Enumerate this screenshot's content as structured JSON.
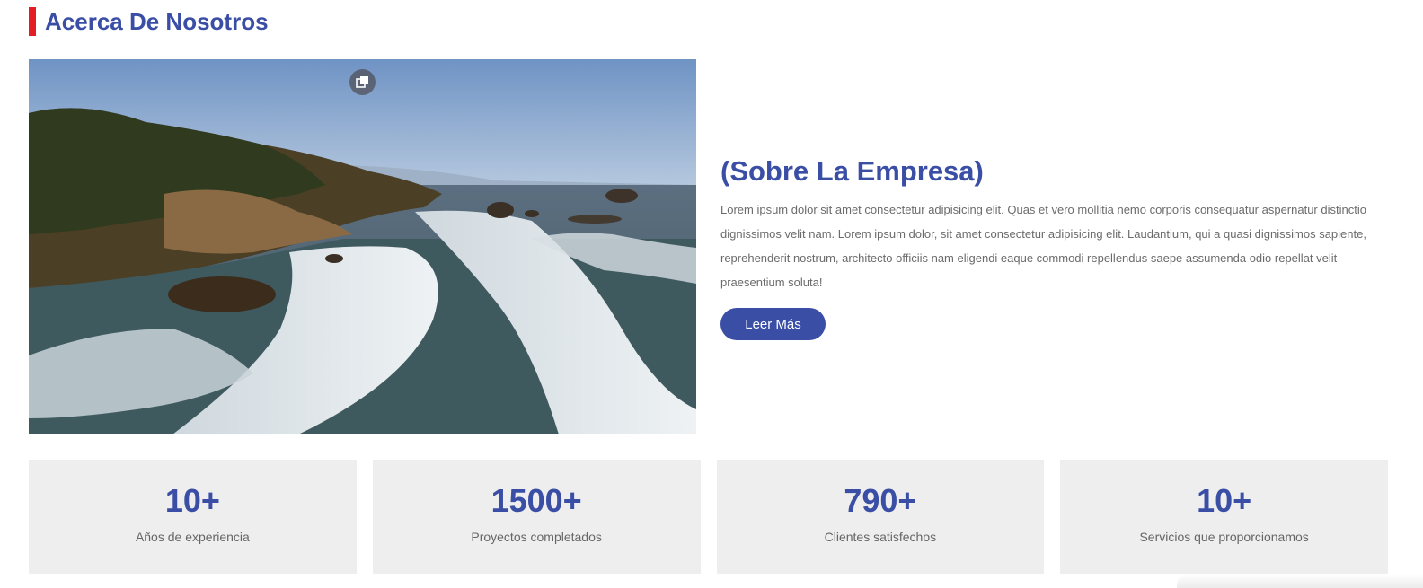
{
  "section": {
    "heading": "Acerca De Nosotros",
    "accent_color": "#e31e24",
    "brand_color": "#3a4ea6"
  },
  "hero": {
    "image_alt": "coastal-cliffs-and-waves",
    "badge_icon": "gallery-icon"
  },
  "about": {
    "title": "(Sobre La Empresa)",
    "body": "Lorem ipsum dolor sit amet consectetur adipisicing elit. Quas et vero mollitia nemo corporis consequatur aspernatur distinctio dignissimos velit nam. Lorem ipsum dolor, sit amet consectetur adipisicing elit. Laudantium, qui a quasi dignissimos sapiente, reprehenderit nostrum, architecto officiis nam eligendi eaque commodi repellendus saepe assumenda odio repellat velit praesentium soluta!",
    "button_label": "Leer Más"
  },
  "stats": [
    {
      "value": "10+",
      "label": "Años de experiencia"
    },
    {
      "value": "1500+",
      "label": "Proyectos completados"
    },
    {
      "value": "790+",
      "label": "Clientes satisfechos"
    },
    {
      "value": "10+",
      "label": "Servicios que proporcionamos"
    }
  ]
}
